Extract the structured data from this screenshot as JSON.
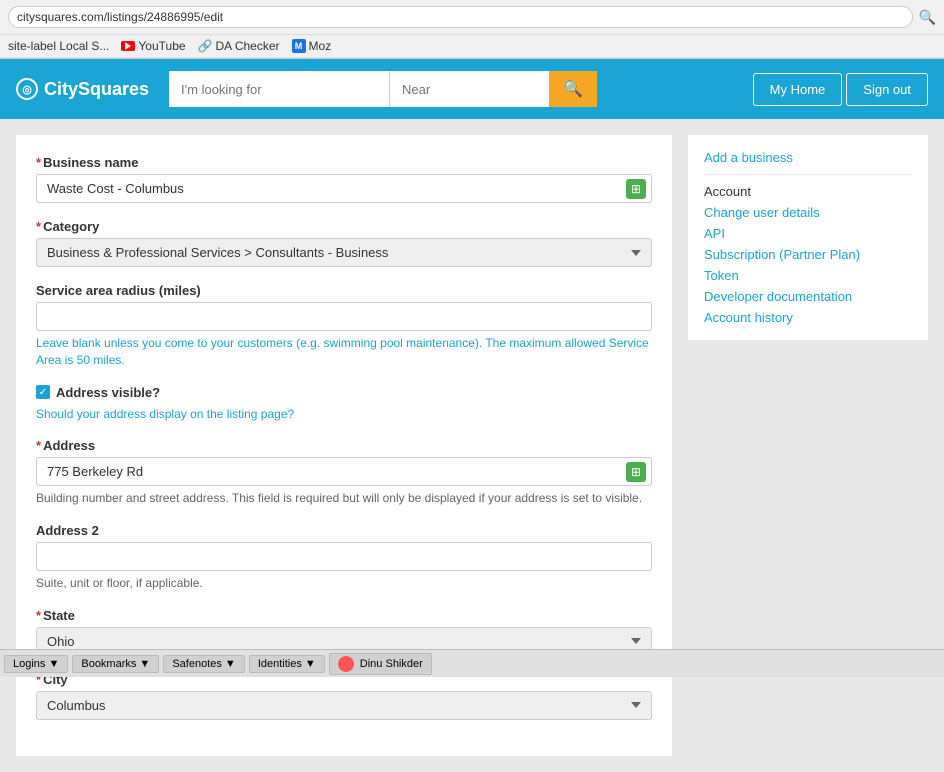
{
  "browser": {
    "address": "citysquares.com/listings/24886995/edit",
    "bookmarks": [
      {
        "label": "site-label Local S...",
        "type": "text"
      },
      {
        "label": "YouTube",
        "type": "youtube"
      },
      {
        "label": "DA Checker",
        "type": "da"
      },
      {
        "label": "Moz",
        "type": "moz"
      }
    ]
  },
  "header": {
    "logo": "CitySquares",
    "search_placeholder": "I'm looking for",
    "near_placeholder": "Near",
    "search_icon": "🔍",
    "my_home": "My Home",
    "sign_out": "Sign out"
  },
  "sidebar": {
    "items": [
      {
        "label": "Add a business",
        "type": "link"
      },
      {
        "label": "Account",
        "type": "plain"
      },
      {
        "label": "Change user details",
        "type": "link"
      },
      {
        "label": "API",
        "type": "link"
      },
      {
        "label": "Subscription (Partner Plan)",
        "type": "link"
      },
      {
        "label": "Token",
        "type": "link"
      },
      {
        "label": "Developer documentation",
        "type": "link"
      },
      {
        "label": "Account history",
        "type": "link"
      }
    ]
  },
  "form": {
    "business_name_label": "Business name",
    "business_name_value": "Waste Cost - Columbus",
    "category_label": "Category",
    "category_value": "Business & Professional Services > Consultants - Business",
    "category_options": [
      "Business & Professional Services > Consultants - Business"
    ],
    "service_area_label": "Service area radius (miles)",
    "service_area_hint": "Leave blank unless you come to your customers (e.g. swimming pool maintenance). The maximum allowed Service Area is 50 miles.",
    "address_visible_label": "Address visible?",
    "address_visible_hint": "Should your address display on the listing page?",
    "address_label": "Address",
    "address_value": "775 Berkeley Rd",
    "address_hint": "Building number and street address. This field is required but will only be displayed if your address is set to visible.",
    "address2_label": "Address 2",
    "address2_value": "",
    "address2_placeholder": "",
    "address2_hint": "Suite, unit or floor, if applicable.",
    "state_label": "State",
    "state_value": "Ohio",
    "state_options": [
      "Ohio"
    ],
    "city_label": "City",
    "city_value": "Columbus",
    "city_options": [
      "Columbus"
    ]
  },
  "taskbar": {
    "items": [
      {
        "label": "Logins ▼"
      },
      {
        "label": "Bookmarks ▼"
      },
      {
        "label": "Safenotes ▼"
      },
      {
        "label": "Identities ▼"
      },
      {
        "label": "Dinu Shikder"
      }
    ]
  }
}
